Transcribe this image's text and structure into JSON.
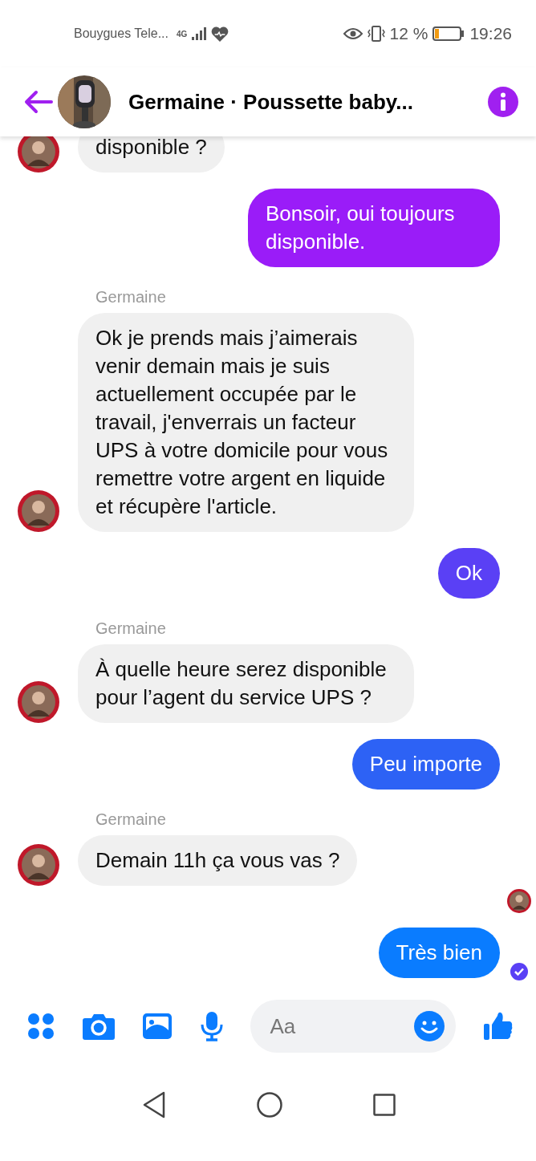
{
  "status_bar": {
    "carrier": "Bouygues Tele...",
    "network": "4G",
    "battery_percent": "12 %",
    "time": "19:26"
  },
  "header": {
    "title": "Germaine · Poussette baby..."
  },
  "messages": [
    {
      "kind": "incoming",
      "text": "disponible ?",
      "avatar": true
    },
    {
      "kind": "outgoing",
      "text": "Bonsoir, oui toujours disponible.",
      "color": "#9a1cf8",
      "delivered": false
    },
    {
      "kind": "incoming",
      "sender": "Germaine",
      "text": "Ok je prends mais j’aimerais venir demain mais je suis actuellement occupée par le travail, j'enverrais un facteur UPS à votre domicile pour vous remettre votre argent en liquide et récupère l'article.",
      "avatar": true
    },
    {
      "kind": "outgoing",
      "text": "Ok",
      "color": "#5a40f5",
      "delivered": false
    },
    {
      "kind": "incoming",
      "sender": "Germaine",
      "text": "À quelle heure serez disponible pour l’agent du service UPS ?",
      "avatar": true
    },
    {
      "kind": "outgoing",
      "text": "Peu importe",
      "color": "#2d62f5",
      "delivered": false
    },
    {
      "kind": "incoming",
      "sender": "Germaine",
      "text": "Demain 11h ça vous vas ?",
      "avatar": true
    },
    {
      "kind": "seen"
    },
    {
      "kind": "outgoing",
      "text": "Très bien",
      "color": "#0a7cff",
      "delivered": true
    }
  ],
  "composer": {
    "placeholder": "Aa"
  }
}
